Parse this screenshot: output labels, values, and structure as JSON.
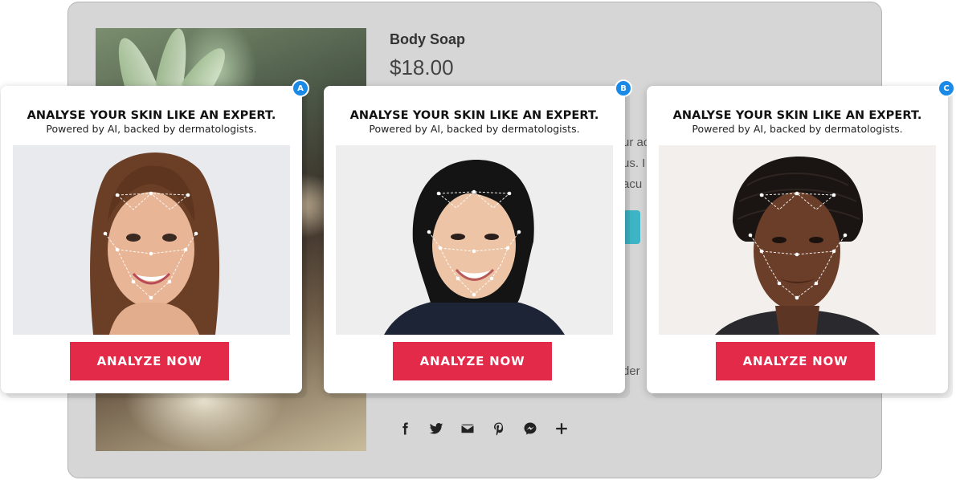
{
  "product": {
    "title": "Body Soap",
    "price": "$18.00",
    "peek_lines": [
      "ur ac",
      "us. I",
      "acu"
    ],
    "peek_order": "der"
  },
  "share_icons": [
    "facebook-icon",
    "twitter-icon",
    "email-icon",
    "pinterest-icon",
    "messenger-icon",
    "plus-icon"
  ],
  "cards": [
    {
      "badge": "A",
      "heading": "ANALYSE YOUR SKIN LIKE AN EXPERT.",
      "subheading": "Powered by AI, backed by dermatologists.",
      "cta": "ANALYZE NOW",
      "hair": "long-brown"
    },
    {
      "badge": "B",
      "heading": "ANALYSE YOUR SKIN LIKE AN EXPERT.",
      "subheading": "Powered by AI, backed by dermatologists.",
      "cta": "ANALYZE NOW",
      "hair": "black-tied"
    },
    {
      "badge": "C",
      "heading": "ANALYSE YOUR SKIN LIKE AN EXPERT.",
      "subheading": "Powered by AI, backed by dermatologists.",
      "cta": "ANALYZE NOW",
      "hair": "black-braids"
    }
  ],
  "colors": {
    "cta": "#e32a48",
    "badge": "#1a8ae6",
    "frame": "#d6d6d6"
  }
}
